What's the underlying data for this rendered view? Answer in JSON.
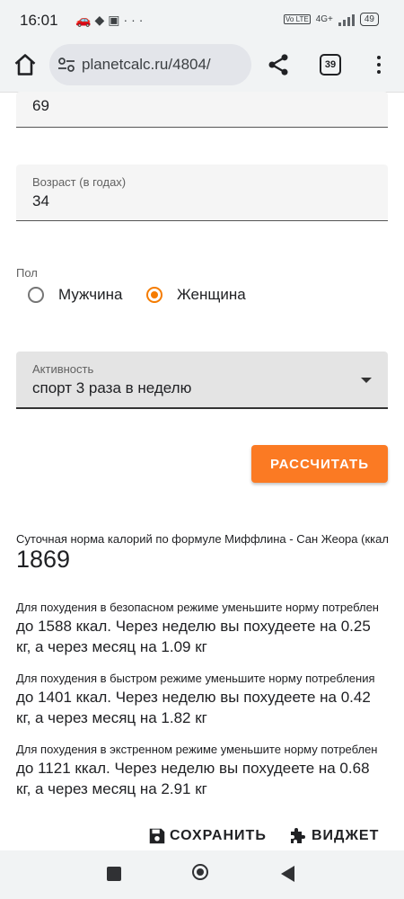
{
  "status_bar": {
    "time": "16:01",
    "notification_icons": [
      "car-icon",
      "puzzle-icon",
      "photo-icon",
      "more-dots-icon"
    ],
    "network": "4G+",
    "battery": "49"
  },
  "browser": {
    "url": "planetcalc.ru/4804/",
    "tab_count": "39"
  },
  "form": {
    "weight": {
      "value": "69"
    },
    "age": {
      "label": "Возраст (в годах)",
      "value": "34"
    },
    "gender": {
      "label": "Пол",
      "options": [
        "Мужчина",
        "Женщина"
      ],
      "selected": "Женщина"
    },
    "activity": {
      "label": "Активность",
      "value": "спорт 3 раза в неделю"
    },
    "calculate_label": "РАССЧИТАТЬ"
  },
  "result": {
    "caption": "Суточная норма калорий по формуле Миффлина - Сан Жеора (ккал",
    "value": "1869"
  },
  "advice": [
    {
      "caption": "Для похудения в безопасном режиме уменьшите норму потреблен",
      "text": "до 1588 ккал. Через неделю вы похудеете на 0.25 кг, а через месяц на 1.09 кг"
    },
    {
      "caption": "Для похудения в быстром режиме уменьшите норму потребления",
      "text": "до 1401 ккал. Через неделю вы похудеете на 0.42 кг, а через месяц на 1.82 кг"
    },
    {
      "caption": "Для похудения в экстренном режиме уменьшите норму потреблен",
      "text": "до 1121 ккал. Через неделю вы похудеете на 0.68 кг, а через месяц на 2.91 кг"
    }
  ],
  "actions": {
    "save_label": "СОХРАНИТЬ",
    "widget_label": "ВИДЖЕТ"
  },
  "colors": {
    "accent": "#fb7a23",
    "radio_checked": "#f57c00"
  }
}
